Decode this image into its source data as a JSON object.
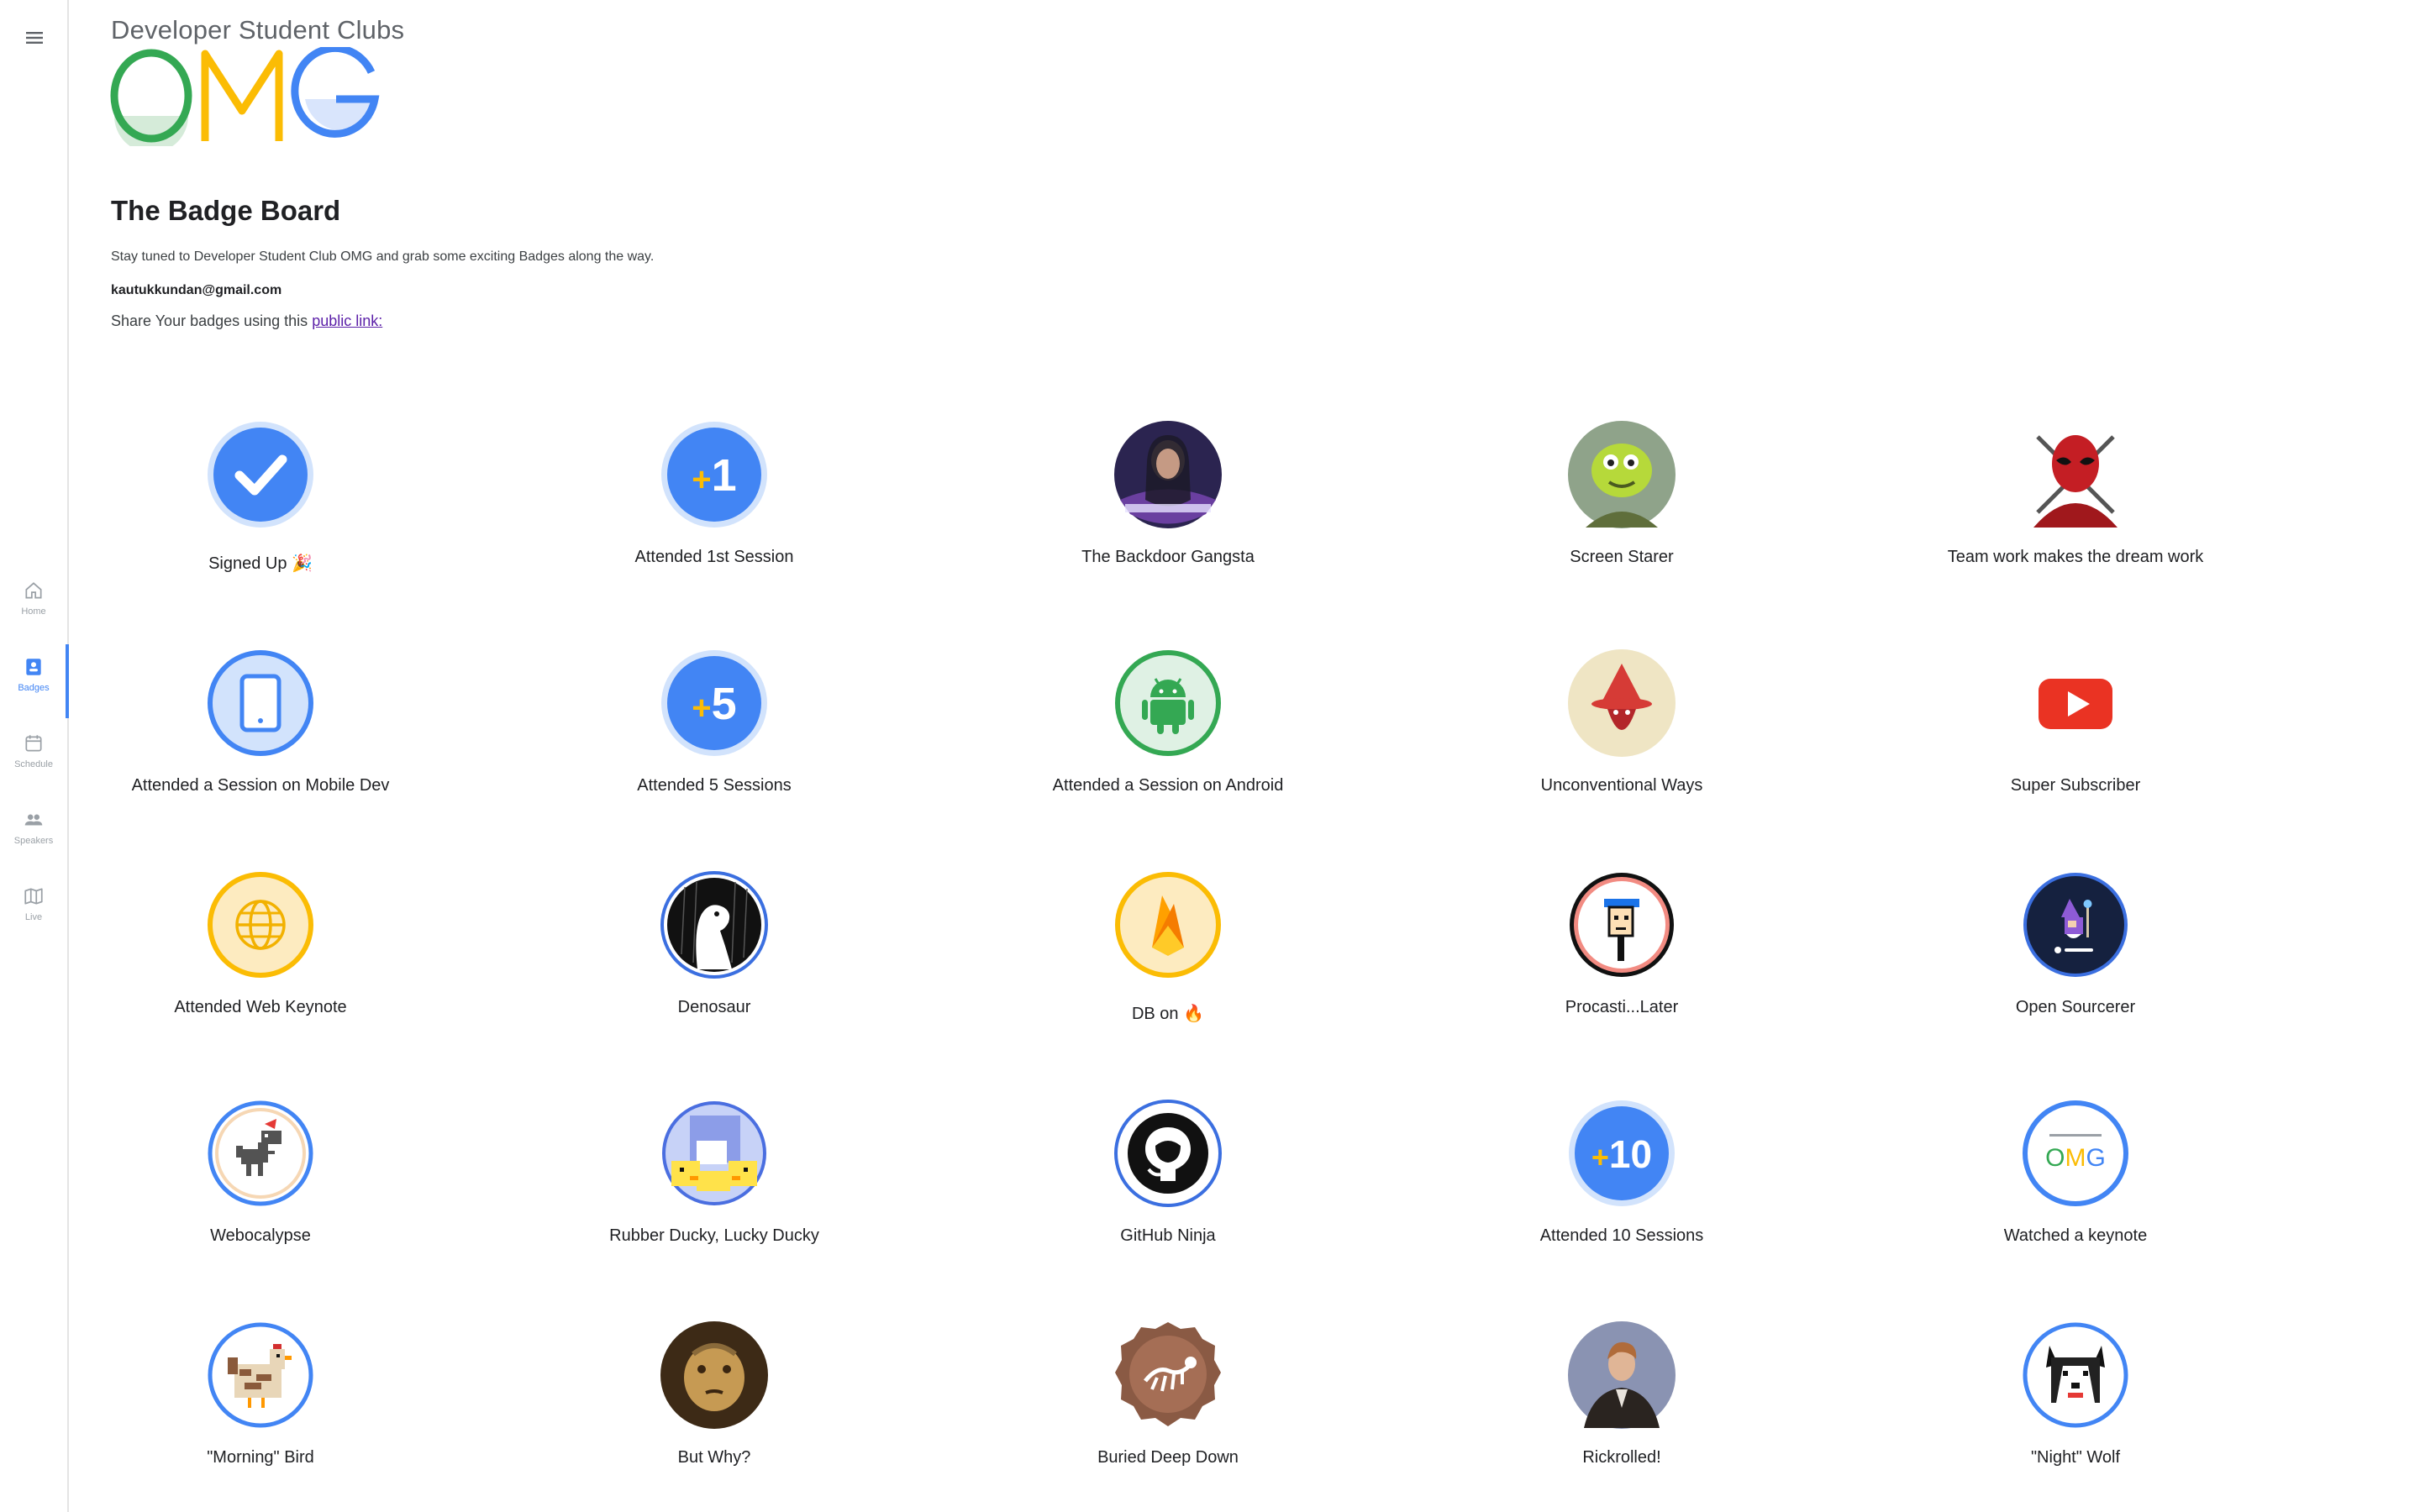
{
  "brand": {
    "top": "Developer Student Clubs",
    "logo": "OMG"
  },
  "nav": {
    "items": [
      {
        "label": "Home",
        "icon": "home-icon"
      },
      {
        "label": "Badges",
        "icon": "badge-icon",
        "active": true
      },
      {
        "label": "Schedule",
        "icon": "calendar-icon"
      },
      {
        "label": "Speakers",
        "icon": "people-icon"
      },
      {
        "label": "Live",
        "icon": "map-icon"
      }
    ]
  },
  "page": {
    "title": "The Badge Board",
    "intro": "Stay tuned to Developer Student Club OMG and grab some exciting Badges along the way.",
    "email": "kautukkundan@gmail.com",
    "share_prefix": "Share Your badges using this ",
    "share_link": "public link:"
  },
  "badges": [
    {
      "label": "Signed Up 🎉"
    },
    {
      "label": "Attended 1st Session",
      "text": "+1"
    },
    {
      "label": "The Backdoor Gangsta"
    },
    {
      "label": "Screen Starer"
    },
    {
      "label": "Team work makes the dream work"
    },
    {
      "label": "Attended a Session on Mobile Dev"
    },
    {
      "label": "Attended 5 Sessions",
      "text": "+5"
    },
    {
      "label": "Attended a Session on Android"
    },
    {
      "label": "Unconventional Ways"
    },
    {
      "label": "Super Subscriber"
    },
    {
      "label": "Attended Web Keynote"
    },
    {
      "label": "Denosaur"
    },
    {
      "label": "DB on 🔥"
    },
    {
      "label": "Procasti...Later"
    },
    {
      "label": "Open Sourcerer"
    },
    {
      "label": "Webocalypse"
    },
    {
      "label": "Rubber Ducky, Lucky Ducky"
    },
    {
      "label": "GitHub Ninja"
    },
    {
      "label": "Attended 10 Sessions",
      "text": "+10"
    },
    {
      "label": "Watched a keynote",
      "text": "OMG"
    },
    {
      "label": "\"Morning\" Bird"
    },
    {
      "label": "But Why?"
    },
    {
      "label": "Buried Deep Down"
    },
    {
      "label": "Rickrolled!"
    },
    {
      "label": "\"Night\" Wolf"
    }
  ],
  "colors": {
    "google_blue": "#4285f4",
    "google_green": "#34a853",
    "google_yellow": "#fbbc04",
    "google_red": "#ea4335",
    "link_purple": "#5b1fa8",
    "text": "#202124",
    "muted": "#9aa0a6"
  }
}
